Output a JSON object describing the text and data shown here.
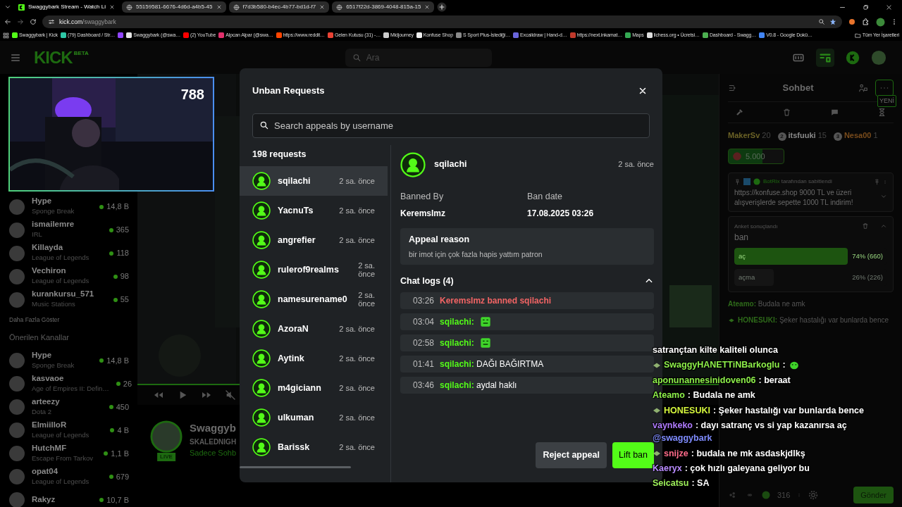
{
  "browser": {
    "tabs": [
      {
        "title": "Swaggybark Stream - Watch Li",
        "kind": "kick",
        "selected": true
      },
      {
        "title": "55159581-6676-4d6d-a4b5-45",
        "kind": "globe",
        "selected": false
      },
      {
        "title": "f7d3b580-b4ec-4b77-bd1d-f7",
        "kind": "globe",
        "selected": false
      },
      {
        "title": "6517f22d-3869-4048-815a-15",
        "kind": "globe",
        "selected": false
      }
    ],
    "url_host": "kick.com",
    "url_path": "/swaggybark",
    "bookmarks": [
      {
        "label": "Swaggybark | Kick",
        "color": "#53fc18"
      },
      {
        "label": "(79) Dashboard / Str…",
        "color": "#2ec7a6"
      },
      {
        "color": "#9146ff"
      },
      {
        "label": "Swaggybark (@swa…",
        "color": "#e6e6e6"
      },
      {
        "label": "(2) YouTube",
        "color": "#ff0000"
      },
      {
        "label": "Alpcan Alpar (@swa…",
        "color": "#e1306c"
      },
      {
        "label": "https://www.reddit…",
        "color": "#ff4500"
      },
      {
        "label": "Gelen Kutusu (31) -…",
        "color": "#ea4335"
      },
      {
        "label": "Midjourney",
        "color": "#cccccc"
      },
      {
        "label": "Konfuse Shop",
        "color": "#f0f0f0"
      },
      {
        "label": "S Sport Plus-İstediği…",
        "color": "#8a8a8a"
      },
      {
        "label": "Excalidraw | Hand-d…",
        "color": "#6965db"
      },
      {
        "label": "https://next.inkamat…",
        "color": "#c0392b"
      },
      {
        "label": "Maps",
        "color": "#34a853"
      },
      {
        "label": "lichess.org • Ücretsi…",
        "color": "#dddddd"
      },
      {
        "label": "Dashboard - Swagg…",
        "color": "#4caf50"
      },
      {
        "label": "V0.8 - Google Dokü…",
        "color": "#4285f4"
      }
    ],
    "all_bookmarks": "Tüm Yer İşaretleri"
  },
  "header": {
    "logo": "KICK",
    "logo_badge": "BETA",
    "search_placeholder": "Ara"
  },
  "webcam": {
    "viewer_count": "788"
  },
  "sidebar": {
    "followed": [
      {
        "name": "Hype",
        "category": "Sponge Break",
        "viewers": "14,8 B"
      },
      {
        "name": "ismailemre",
        "category": "IRL",
        "viewers": "365"
      },
      {
        "name": "Killayda",
        "category": "League of Legends",
        "viewers": "118"
      },
      {
        "name": "Vechiron",
        "category": "League of Legends",
        "viewers": "98"
      },
      {
        "name": "kurankursu_571",
        "category": "Music Stations",
        "viewers": "55"
      }
    ],
    "show_more": "Daha Fazla Göster",
    "recommended_title": "Önerilen Kanallar",
    "recommended": [
      {
        "name": "Hype",
        "category": "Sponge Break",
        "viewers": "14,8 B"
      },
      {
        "name": "kasvaoe",
        "category": "Age of Empires II: Defin…",
        "viewers": "26"
      },
      {
        "name": "arteezy",
        "category": "Dota 2",
        "viewers": "450"
      },
      {
        "name": "ElmiilloR",
        "category": "League of Legends",
        "viewers": "4 B"
      },
      {
        "name": "HutchMF",
        "category": "Escape From Tarkov",
        "viewers": "1,1 B"
      },
      {
        "name": "opat04",
        "category": "League of Legends",
        "viewers": "679"
      },
      {
        "name": "Rakyz",
        "viewers": "10,7 B"
      }
    ]
  },
  "stream": {
    "live_badge": "LIVE",
    "title": "Swaggyb",
    "category": "SKALEDNIGH",
    "note": "Sadece Sohb"
  },
  "chat": {
    "title": "Sohbet",
    "new_badge": "YENİ",
    "leaderboard": [
      {
        "name": "MakerSv",
        "count": "20",
        "color": "#6b6226"
      },
      {
        "rank": "2",
        "name": "itsfuuki",
        "count": "15",
        "color": "#8a8a8a"
      },
      {
        "rank": "3",
        "name": "Nesa00",
        "count": "1",
        "color": "#7a4c1c"
      }
    ],
    "goal": "5.000",
    "pinned": {
      "by": "BotRix",
      "by_suffix": "tarafından sabitlendi",
      "link": "https://konfuse.shop",
      "text": "9000 TL ve üzeri alışverişlerde sepette 1000 TL indirim!"
    },
    "poll": {
      "status": "Anket sonuçlandı",
      "question": "ban",
      "options": [
        {
          "label": "aç",
          "result": "74% (660)",
          "level": 0.74,
          "selected": true
        },
        {
          "label": "açma",
          "result": "26% (226)",
          "level": 0.26,
          "selected": false
        }
      ]
    },
    "messages": [
      {
        "user": "Ateamo:",
        "text": "Budala ne amk",
        "badge": false
      },
      {
        "user": "HONESUKI:",
        "text": "Şeker hastalığı var bunlarda bence",
        "badge": true
      }
    ],
    "viewers": "316",
    "send": "Gönder"
  },
  "overlay_chat": [
    {
      "kind": "continuation",
      "text": "satrançtan kilte kaliteli olunca"
    },
    {
      "kind": "message",
      "user": "SwaggyHANETTiNBarkoglu",
      "color": "#8ef04a",
      "badge": true,
      "text": ":",
      "emote": true
    },
    {
      "kind": "message",
      "user": "aponunannesinidoven06",
      "color": "#8ef04a",
      "text": ": beraat"
    },
    {
      "kind": "message",
      "user": "Ateamo",
      "color": "#8ef04a",
      "text": ": Budala ne amk"
    },
    {
      "kind": "message",
      "user": "HONESUKI",
      "color": "#d4f53c",
      "badge": true,
      "text": ": Şeker hastalığı var bunlarda bence"
    },
    {
      "kind": "message",
      "user": "vaynkeko",
      "color": "#b07bff",
      "text": ": dayı satranç vs si yap kazanırsa aç",
      "mention": "@swaggybark"
    },
    {
      "kind": "message",
      "user": "snijze",
      "color": "#ff6b8a",
      "badge": true,
      "text": ": budala ne mk asdaskjdlkş"
    },
    {
      "kind": "message",
      "user": "Kaeryx",
      "color": "#b98cff",
      "text": ": çok hızlı galeyana geliyor bu"
    },
    {
      "kind": "message",
      "user": "Seicatsu",
      "color": "#9ef05a",
      "text": ": SA"
    }
  ],
  "modal": {
    "title": "Unban Requests",
    "search_placeholder": "Search appeals by username",
    "count": "198 requests",
    "requests": [
      {
        "name": "sqilachi",
        "time": "2 sa. önce",
        "selected": true
      },
      {
        "name": "YacnuTs",
        "time": "2 sa. önce",
        "selected": false
      },
      {
        "name": "angrefier",
        "time": "2 sa. önce",
        "selected": false
      },
      {
        "name": "rulerof9realms",
        "time": "2 sa. önce",
        "selected": false
      },
      {
        "name": "namesurename0",
        "time": "2 sa. önce",
        "selected": false
      },
      {
        "name": "AzoraN",
        "time": "2 sa. önce",
        "selected": false
      },
      {
        "name": "Aytink",
        "time": "2 sa. önce",
        "selected": false
      },
      {
        "name": "m4giciann",
        "time": "2 sa. önce",
        "selected": false
      },
      {
        "name": "ulkuman",
        "time": "2 sa. önce",
        "selected": false
      },
      {
        "name": "Barissk",
        "time": "2 sa. önce",
        "selected": false
      }
    ],
    "detail": {
      "name": "sqilachi",
      "time": "2 sa. önce",
      "banned_by_label": "Banned By",
      "banned_by": "KeremsImz",
      "ban_date_label": "Ban date",
      "ban_date": "17.08.2025 03:26",
      "appeal_title": "Appeal reason",
      "appeal_text": "bir imot için çok fazla hapis yattım patron",
      "logs_title": "Chat logs (4)",
      "logs_expanded": true,
      "logs": [
        {
          "time": "03:26",
          "kind": "ban",
          "text": "KeremsImz banned sqilachi"
        },
        {
          "time": "03:04",
          "kind": "message",
          "user": "sqilachi:",
          "emote": true
        },
        {
          "time": "02:58",
          "kind": "message",
          "user": "sqilachi:",
          "emote": true
        },
        {
          "time": "01:41",
          "kind": "message",
          "user": "sqilachi:",
          "text": "DAĞI BAĞIRTMA"
        },
        {
          "time": "03:46",
          "kind": "message",
          "user": "sqilachi:",
          "text": "aydal haklı"
        }
      ]
    },
    "buttons": [
      {
        "label": "Reject appeal",
        "kind": "secondary"
      },
      {
        "label": "Lift ban",
        "kind": "primary"
      }
    ]
  }
}
